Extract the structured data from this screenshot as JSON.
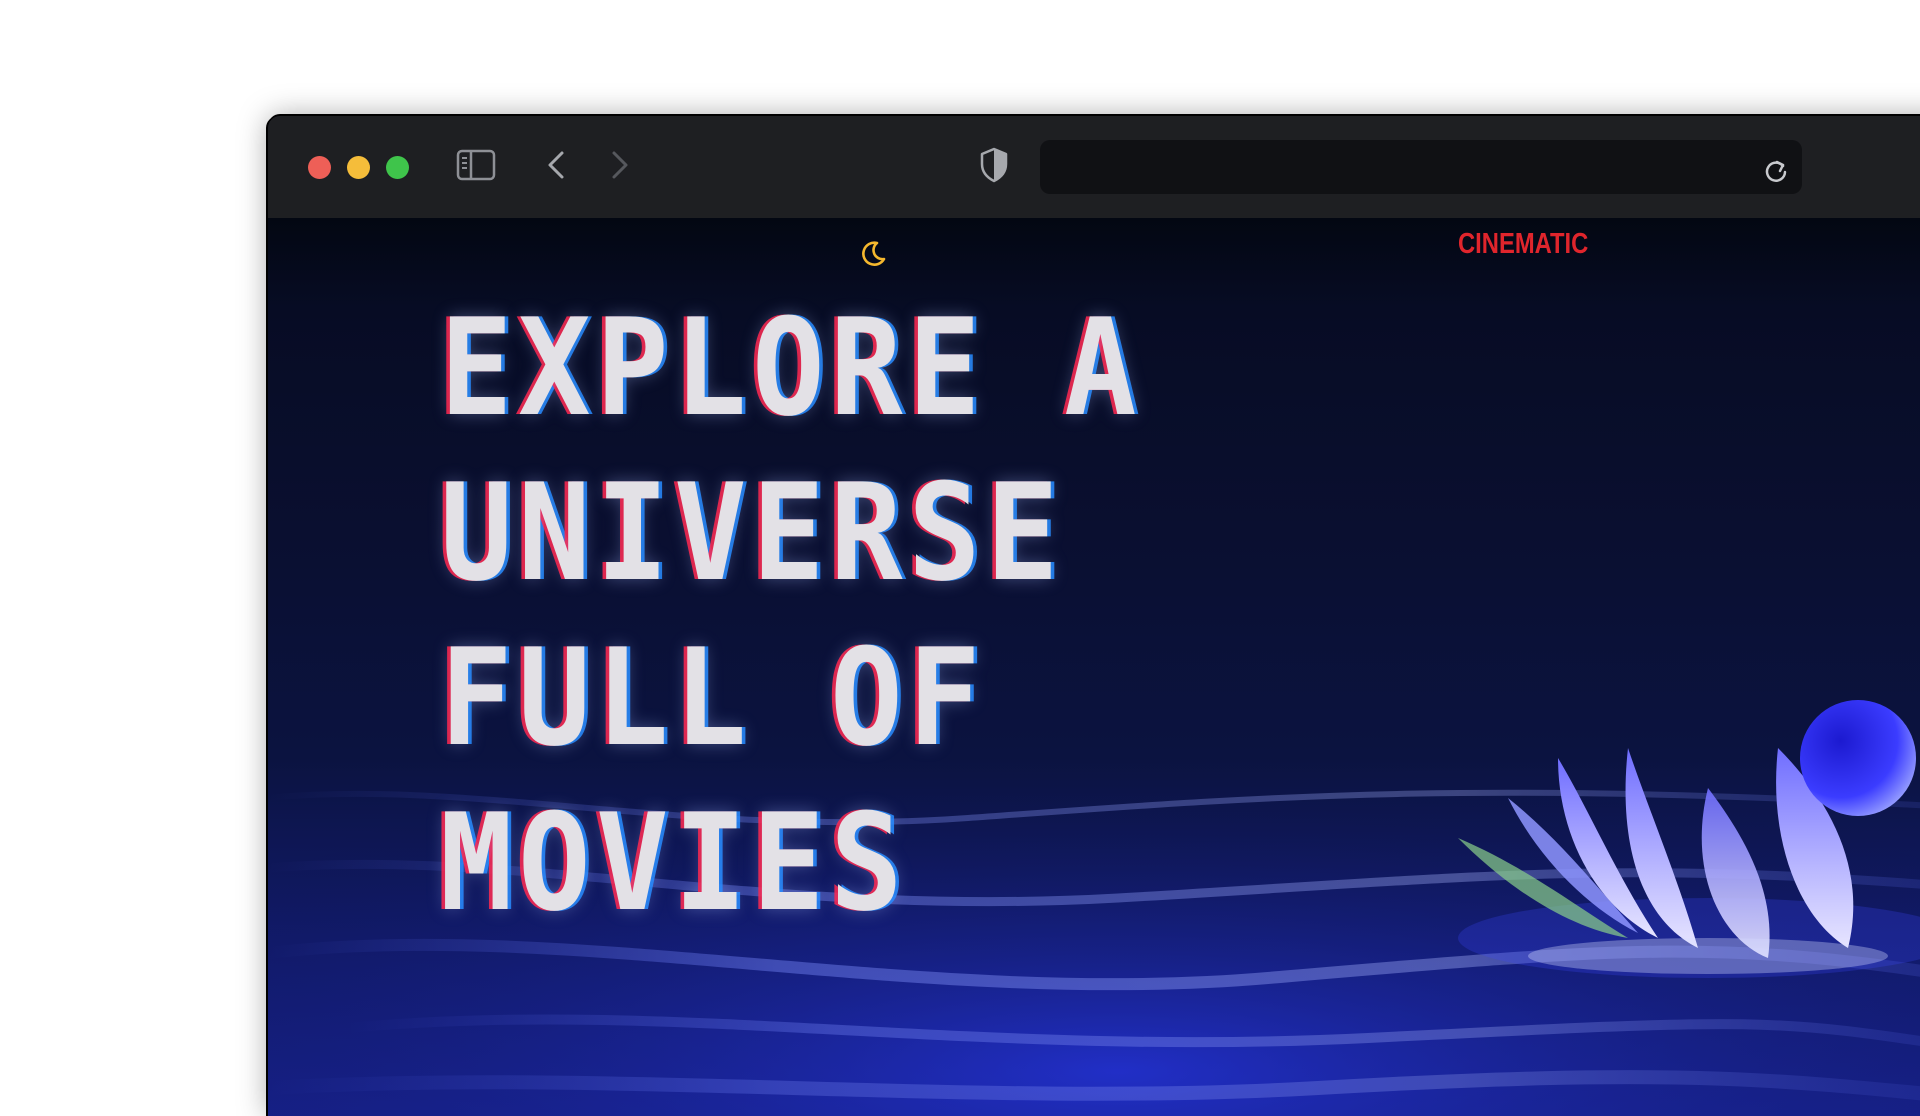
{
  "browser": {
    "address": ""
  },
  "site": {
    "brand": "CINEMATIC",
    "hero_lines": [
      "EXPLORE A",
      "UNIVERSE",
      "FULL OF",
      "MOVIES"
    ]
  },
  "icons": {
    "sidebar": "sidebar-icon",
    "back": "chevron-left-icon",
    "forward": "chevron-right-icon",
    "privacy": "shield-icon",
    "reload": "reload-icon",
    "theme": "moon-icon"
  },
  "colors": {
    "brand_red": "#e0252c",
    "moon_yellow": "#f5b82e",
    "hero_text": "#e3e1e6",
    "background": "#0a0f30"
  }
}
